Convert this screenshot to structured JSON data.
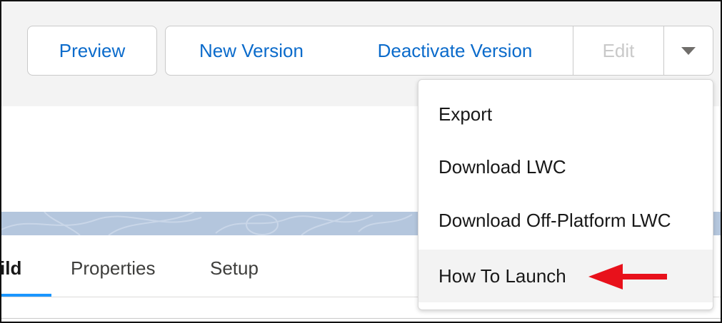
{
  "toolbar": {
    "preview_label": "Preview",
    "new_version_label": "New Version",
    "deactivate_version_label": "Deactivate Version",
    "edit_label": "Edit",
    "more_actions_icon": "chevron-down-icon"
  },
  "dropdown_menu": {
    "items": [
      {
        "label": "Export"
      },
      {
        "label": "Download LWC"
      },
      {
        "label": "Download Off-Platform LWC"
      },
      {
        "label": "How To Launch",
        "highlighted": true
      }
    ]
  },
  "tabs": {
    "items": [
      {
        "label": "ild",
        "active": true
      },
      {
        "label": "Properties"
      },
      {
        "label": "Setup"
      }
    ]
  },
  "annotation": {
    "arrow_icon": "red-arrow-icon",
    "arrow_color": "#e8111b"
  },
  "colors": {
    "link_blue": "#0b6bcb",
    "tab_accent": "#1b96ff",
    "header_bg": "#f3f3f3",
    "banner_bg": "#b4c6dd"
  }
}
